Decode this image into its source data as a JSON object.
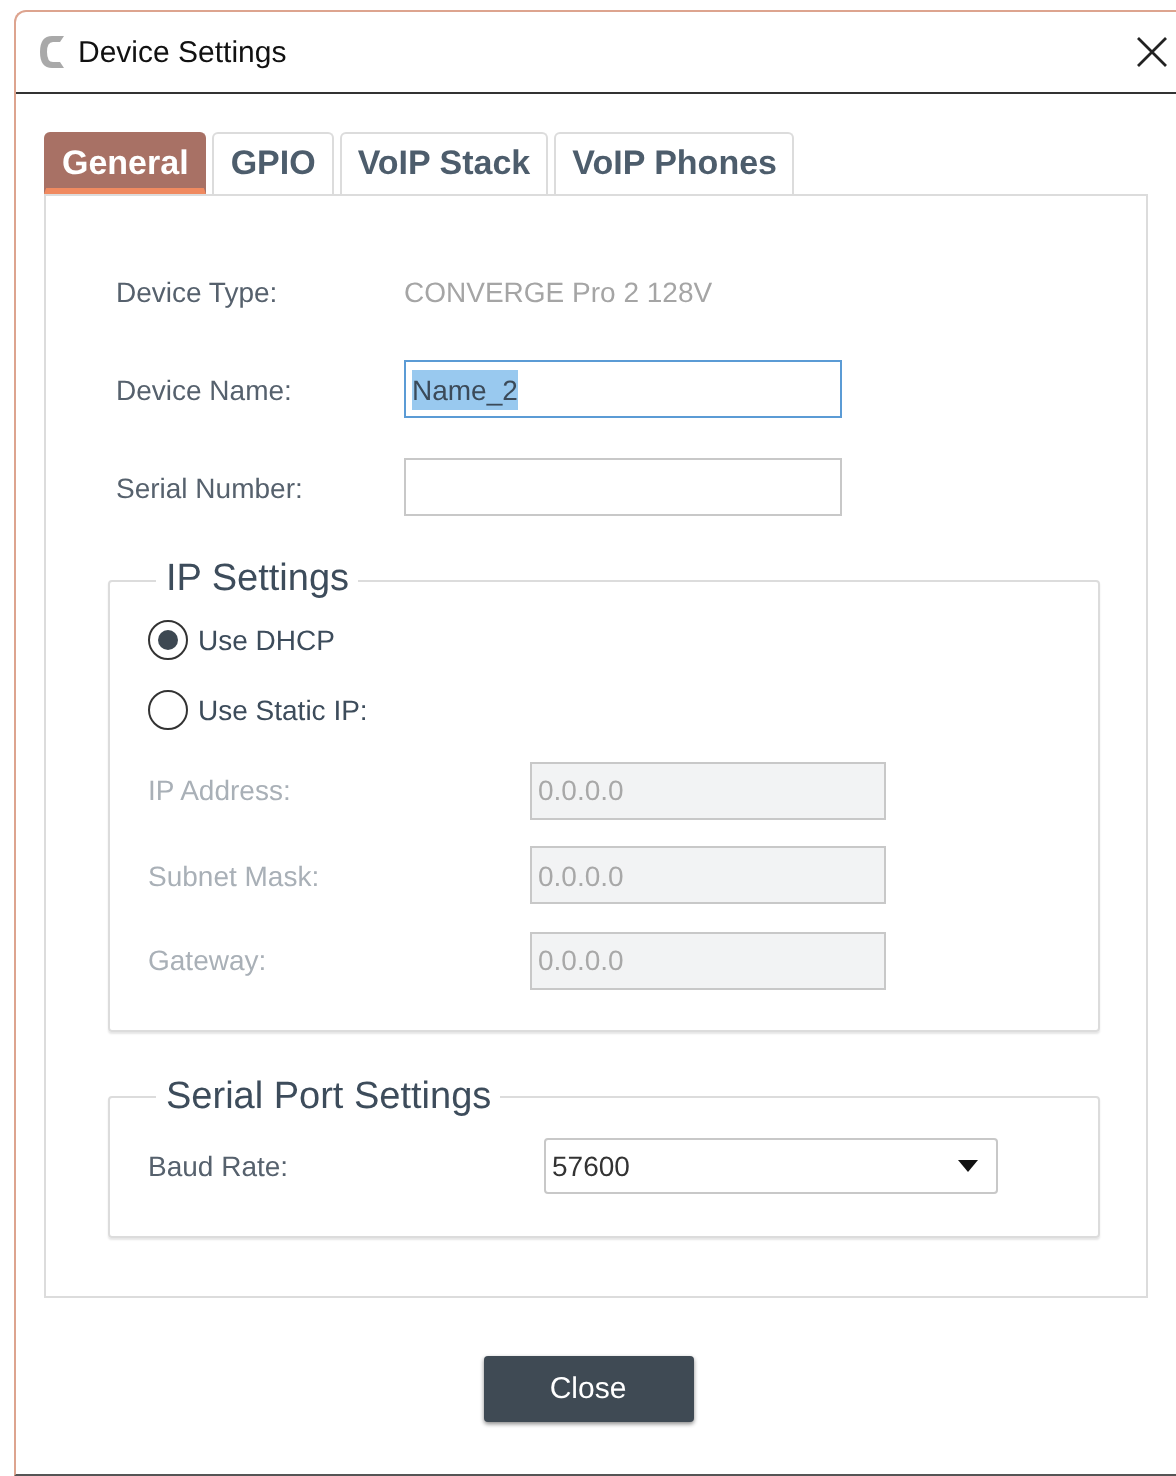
{
  "window": {
    "title": "Device Settings"
  },
  "tabs": [
    {
      "label": "General",
      "selected": true
    },
    {
      "label": "GPIO",
      "selected": false
    },
    {
      "label": "VoIP Stack",
      "selected": false
    },
    {
      "label": "VoIP Phones",
      "selected": false
    }
  ],
  "general": {
    "fields": [
      {
        "kind": "readonly",
        "label": "Device Type:",
        "value": "CONVERGE Pro 2 128V"
      },
      {
        "kind": "input",
        "label": "Device Name:",
        "value": "Name_2",
        "focused": true,
        "highlighted": true
      },
      {
        "kind": "input",
        "label": "Serial Number:",
        "focused": false
      }
    ]
  },
  "ip_settings": {
    "title": "IP Settings",
    "options": [
      {
        "label": "Use DHCP",
        "selected": true
      },
      {
        "label": "Use Static IP:",
        "selected": false
      }
    ],
    "fields": [
      {
        "label": "IP Address:",
        "value": "0.0.0.0",
        "disabled": true
      },
      {
        "label": "Subnet Mask:",
        "value": "0.0.0.0",
        "disabled": true
      },
      {
        "label": "Gateway:",
        "value": "0.0.0.0",
        "disabled": true
      }
    ]
  },
  "serial_port_settings": {
    "title": "Serial Port Settings",
    "baud_rate": {
      "label": "Baud Rate:",
      "value": "57600"
    }
  },
  "buttons": [
    {
      "label": "Close"
    }
  ]
}
